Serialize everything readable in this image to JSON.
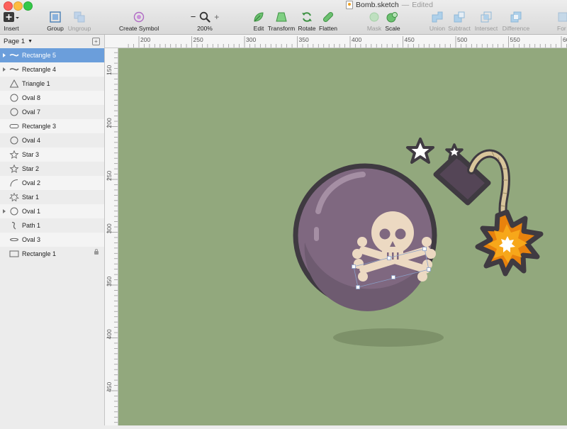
{
  "window": {
    "document_name": "Bomb.sketch",
    "separator": "—",
    "status": "Edited",
    "traffic_lights": [
      "#fc605c",
      "#fdbc40",
      "#34c84a"
    ]
  },
  "toolbar": {
    "tools": [
      {
        "label": "Insert",
        "icon": "plus-icon"
      },
      {
        "label": "Group",
        "icon": "group-icon"
      },
      {
        "label": "Ungroup",
        "icon": "ungroup-icon",
        "disabled": true
      },
      {
        "label": "Create Symbol",
        "icon": "symbol-icon"
      },
      {
        "label": "200%",
        "icon": "zoom-icon"
      },
      {
        "label": "Edit",
        "icon": "edit-icon"
      },
      {
        "label": "Transform",
        "icon": "transform-icon"
      },
      {
        "label": "Rotate",
        "icon": "rotate-icon"
      },
      {
        "label": "Flatten",
        "icon": "flatten-icon"
      },
      {
        "label": "Mask",
        "icon": "mask-icon",
        "disabled": true
      },
      {
        "label": "Scale",
        "icon": "scale-icon"
      },
      {
        "label": "Union",
        "icon": "union-icon",
        "disabled": true
      },
      {
        "label": "Subtract",
        "icon": "subtract-icon",
        "disabled": true
      },
      {
        "label": "Intersect",
        "icon": "intersect-icon",
        "disabled": true
      },
      {
        "label": "Difference",
        "icon": "difference-icon",
        "disabled": true
      },
      {
        "label": "For",
        "icon": "forward-icon",
        "disabled": true
      }
    ],
    "zoom_minus": "−",
    "zoom_plus": "+"
  },
  "sidebar": {
    "page": "Page 1",
    "layers": [
      {
        "name": "Rectangle 5",
        "icon": "path-wavy-icon",
        "selected": true,
        "group": true
      },
      {
        "name": "Rectangle 4",
        "icon": "path-wavy-icon",
        "group": true
      },
      {
        "name": "Triangle 1",
        "icon": "triangle-icon"
      },
      {
        "name": "Oval 8",
        "icon": "oval-icon"
      },
      {
        "name": "Oval 7",
        "icon": "oval-icon"
      },
      {
        "name": "Rectangle 3",
        "icon": "rounded-rectangle-icon"
      },
      {
        "name": "Oval 4",
        "icon": "oval-icon"
      },
      {
        "name": "Star 3",
        "icon": "star-icon"
      },
      {
        "name": "Star 2",
        "icon": "star-icon"
      },
      {
        "name": "Oval 2",
        "icon": "arc-icon"
      },
      {
        "name": "Star 1",
        "icon": "starburst-icon"
      },
      {
        "name": "Oval 1",
        "icon": "oval-icon",
        "group": true
      },
      {
        "name": "Path 1",
        "icon": "path-icon"
      },
      {
        "name": "Oval 3",
        "icon": "flat-oval-icon"
      },
      {
        "name": "Rectangle 1",
        "icon": "rectangle-icon",
        "locked": true
      }
    ]
  },
  "rulers": {
    "horizontal": [
      "200",
      "250",
      "300",
      "350",
      "400",
      "450",
      "500",
      "550",
      "600"
    ],
    "vertical": [
      "150",
      "200",
      "250",
      "300",
      "350",
      "400",
      "450"
    ]
  },
  "canvas": {
    "background": "#92a87d",
    "artwork": "bomb"
  }
}
